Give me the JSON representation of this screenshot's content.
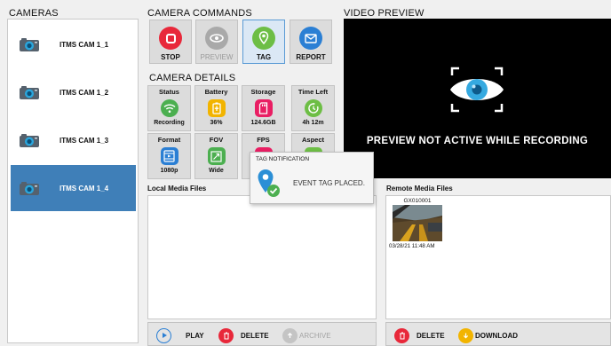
{
  "cameras": {
    "title": "CAMERAS",
    "items": [
      {
        "label": "ITMS CAM 1_1",
        "selected": false
      },
      {
        "label": "ITMS CAM 1_2",
        "selected": false
      },
      {
        "label": "ITMS CAM 1_3",
        "selected": false
      },
      {
        "label": "ITMS CAM 1_4",
        "selected": true
      }
    ]
  },
  "commands": {
    "title": "CAMERA COMMANDS",
    "stop": "STOP",
    "preview": "PREVIEW",
    "tag": "TAG",
    "report": "REPORT"
  },
  "details": {
    "title": "CAMERA DETAILS",
    "status": {
      "head": "Status",
      "value": "Recording"
    },
    "battery": {
      "head": "Battery",
      "value": "36%"
    },
    "storage": {
      "head": "Storage",
      "value": "124.6GB"
    },
    "time_left": {
      "head": "Time Left",
      "value": "4h 12m"
    },
    "format": {
      "head": "Format",
      "value": "1080p"
    },
    "fov": {
      "head": "FOV",
      "value": "Wide"
    },
    "fps": {
      "head": "FPS",
      "value": ""
    },
    "aspect": {
      "head": "Aspect",
      "value": ""
    }
  },
  "preview": {
    "title": "VIDEO PREVIEW",
    "message": "PREVIEW NOT ACTIVE WHILE RECORDING"
  },
  "local_media": {
    "title": "Local Media Files",
    "play": "PLAY",
    "delete": "DELETE",
    "archive": "ARCHIVE"
  },
  "remote_media": {
    "title": "Remote Media Files",
    "files": [
      {
        "name": "GX010001",
        "timestamp": "03/28/21 11:48 AM"
      }
    ],
    "delete": "DELETE",
    "download": "DOWNLOAD"
  },
  "notification": {
    "title": "TAG NOTIFICATION",
    "message": "EVENT TAG PLACED."
  },
  "colors": {
    "selected": "#3f7fb8",
    "stop_red": "#e8283a",
    "tag_green": "#6dbe45",
    "report_blue": "#2b7fd4",
    "status_green": "#4caf50",
    "battery_yellow": "#f2b400",
    "storage_pink": "#e91e63"
  }
}
